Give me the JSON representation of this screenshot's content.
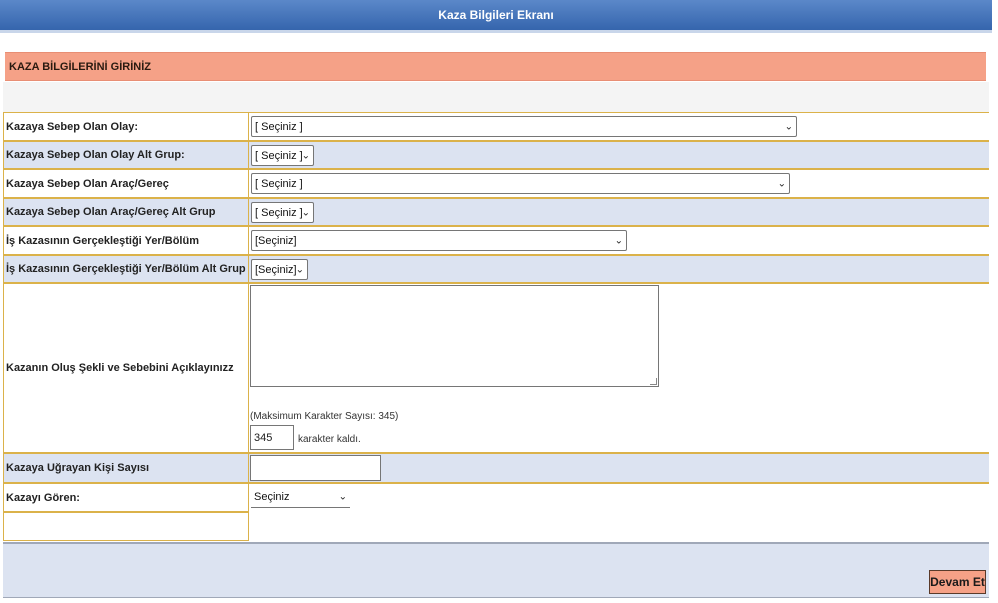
{
  "window": {
    "title": "Kaza Bilgileri Ekranı"
  },
  "section": {
    "header": "KAZA BİLGİLERİNİ GİRİNİZ"
  },
  "form": {
    "rows": [
      {
        "label": "Kazaya Sebep Olan Olay:",
        "selected": "[ Seçiniz ]"
      },
      {
        "label": "Kazaya Sebep Olan Olay Alt Grup:",
        "selected": "[ Seçiniz ]"
      },
      {
        "label": "Kazaya Sebep Olan Araç/Gereç",
        "selected": "[ Seçiniz ]"
      },
      {
        "label": "Kazaya Sebep Olan Araç/Gereç Alt Grup",
        "selected": "[ Seçiniz ]"
      },
      {
        "label": "İş Kazasının Gerçekleştiği Yer/Bölüm",
        "selected": "[Seçiniz]"
      },
      {
        "label": "İş Kazasının Gerçekleştiği Yer/Bölüm Alt Grup",
        "selected": "[Seçiniz]"
      }
    ],
    "description": {
      "label": "Kazanın Oluş Şekli ve Sebebini Açıklayınızz",
      "value": "",
      "max_note": "(Maksimum Karakter Sayısı: 345)",
      "remaining": "345",
      "remaining_suffix": "karakter kaldı."
    },
    "person_count": {
      "label": "Kazaya Uğrayan Kişi Sayısı",
      "value": ""
    },
    "witness": {
      "label": "Kazayı Gören:",
      "selected": "Seçiniz"
    }
  },
  "footer": {
    "submit_label": "Devam Et"
  },
  "colors": {
    "title_bar": "#3f6fb4",
    "section_header": "#f5a187",
    "row_alt": "#dce3f1",
    "border": "#dbb24a"
  },
  "icons": {
    "select_arrow": "chevron-down-icon",
    "resize": "resize-grip-icon"
  }
}
